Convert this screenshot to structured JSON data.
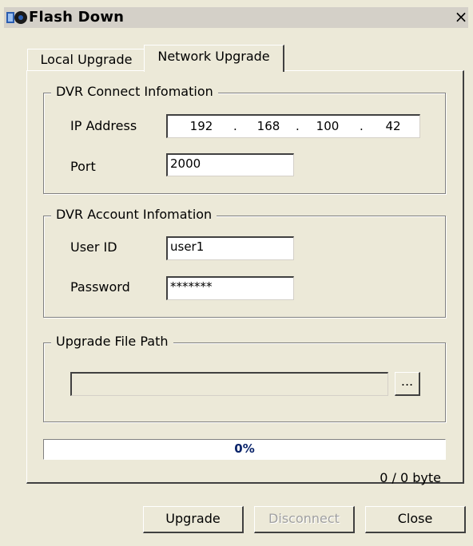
{
  "window": {
    "title": "Flash Down",
    "close_glyph": "×",
    "icon": "app-icon"
  },
  "tabs": [
    {
      "label": "Local Upgrade",
      "active": false
    },
    {
      "label": "Network Upgrade",
      "active": true
    }
  ],
  "connect_group": {
    "title": "DVR Connect Infomation",
    "ip_label": "IP Address",
    "ip": [
      "192",
      "168",
      "100",
      "42"
    ],
    "ip_separator": ".",
    "port_label": "Port",
    "port_value": "2000"
  },
  "account_group": {
    "title": "DVR Account Infomation",
    "user_label": "User ID",
    "user_value": "user1",
    "password_label": "Password",
    "password_value": "*******"
  },
  "file_group": {
    "title": "Upgrade File Path",
    "path_value": "",
    "browse_label": "..."
  },
  "progress": {
    "percent": 0,
    "percent_text": "0%",
    "bytes_text": "0 / 0 byte"
  },
  "buttons": {
    "upgrade": "Upgrade",
    "disconnect": "Disconnect",
    "close": "Close"
  }
}
